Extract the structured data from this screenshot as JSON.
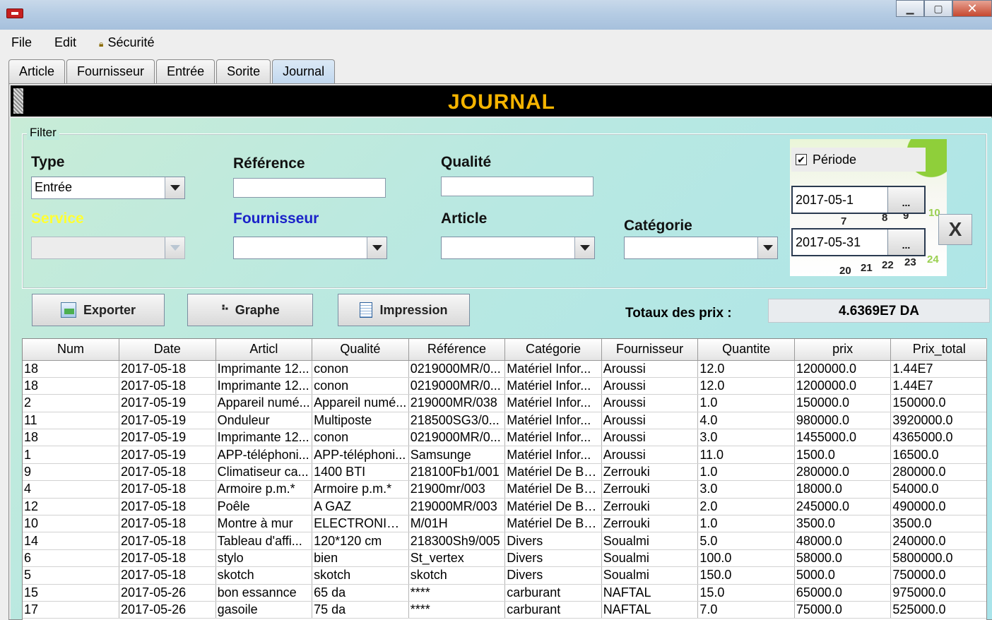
{
  "window": {
    "title": "",
    "minimize_glyph": "▁",
    "maximize_glyph": "▢",
    "close_glyph": "✕"
  },
  "menu": {
    "items": [
      "File",
      "Edit",
      "Sécurité"
    ]
  },
  "tabs": [
    {
      "label": "Article",
      "active": false
    },
    {
      "label": "Fournisseur",
      "active": false
    },
    {
      "label": "Entrée",
      "active": false
    },
    {
      "label": "Sorite",
      "active": false
    },
    {
      "label": "Journal",
      "active": true
    }
  ],
  "header": {
    "title": "JOURNAL"
  },
  "filter": {
    "legend": "Filter",
    "type_label": "Type",
    "type_value": "Entrée",
    "reference_label": "Référence",
    "reference_value": "",
    "qualite_label": "Qualité",
    "qualite_value": "",
    "service_label": "Service",
    "service_value": "",
    "fournisseur_label": "Fournisseur",
    "fournisseur_value": "",
    "article_label": "Article",
    "article_value": "",
    "categorie_label": "Catégorie",
    "categorie_value": "",
    "periode_label": "Période",
    "periode_checked": true,
    "date_from": "2017-05-1",
    "date_to": "2017-05-31",
    "date_button": "...",
    "clear_button": "X"
  },
  "actions": {
    "export_label": "Exporter",
    "graph_label": "Graphe",
    "print_label": "Impression",
    "total_label": "Totaux des prix :",
    "total_value": "4.6369E7 DA"
  },
  "table": {
    "columns": [
      "Num",
      "Date",
      "Articl",
      "Qualité",
      "Référence",
      "Catégorie",
      "Fournisseur",
      "Quantite",
      "prix",
      "Prix_total"
    ],
    "rows": [
      [
        "18",
        "2017-05-18",
        "Imprimante 12...",
        "conon",
        "0219000MR/0...",
        "Matériel Infor...",
        "Aroussi",
        "12.0",
        "1200000.0",
        "1.44E7"
      ],
      [
        "18",
        "2017-05-18",
        "Imprimante 12...",
        "conon",
        "0219000MR/0...",
        "Matériel Infor...",
        "Aroussi",
        "12.0",
        "1200000.0",
        "1.44E7"
      ],
      [
        "2",
        "2017-05-19",
        "Appareil numé...",
        "Appareil numé...",
        "219000MR/038",
        "Matériel Infor...",
        "Aroussi",
        "1.0",
        "150000.0",
        "150000.0"
      ],
      [
        "11",
        "2017-05-19",
        "Onduleur",
        "Multiposte",
        "218500SG3/0...",
        "Matériel Infor...",
        "Aroussi",
        "4.0",
        "980000.0",
        "3920000.0"
      ],
      [
        "18",
        "2017-05-19",
        "Imprimante 12...",
        "conon",
        "0219000MR/0...",
        "Matériel Infor...",
        "Aroussi",
        "3.0",
        "1455000.0",
        "4365000.0"
      ],
      [
        "1",
        "2017-05-19",
        "APP-téléphoni...",
        "APP-téléphoni...",
        "Samsunge",
        "Matériel Infor...",
        "Aroussi",
        "11.0",
        "1500.0",
        "16500.0"
      ],
      [
        "9",
        "2017-05-18",
        "Climatiseur ca...",
        "1400 BTI",
        "218100Fb1/001",
        "Matériel De Bu...",
        "Zerrouki",
        "1.0",
        "280000.0",
        "280000.0"
      ],
      [
        "4",
        "2017-05-18",
        "Armoire p.m.*",
        "Armoire p.m.*",
        "21900mr/003",
        "Matériel De Bu...",
        "Zerrouki",
        "3.0",
        "18000.0",
        "54000.0"
      ],
      [
        "12",
        "2017-05-18",
        "Poêle",
        "A  GAZ",
        "219000MR/003",
        "Matériel De Bu...",
        "Zerrouki",
        "2.0",
        "245000.0",
        "490000.0"
      ],
      [
        "10",
        "2017-05-18",
        "Montre à mur",
        "ELECTRONIQ...",
        "M/01H",
        "Matériel De Bu...",
        "Zerrouki",
        "1.0",
        "3500.0",
        "3500.0"
      ],
      [
        "14",
        "2017-05-18",
        "Tableau d'affi...",
        "120*120 cm",
        "218300Sh9/005",
        "Divers",
        "Soualmi",
        "5.0",
        "48000.0",
        "240000.0"
      ],
      [
        "6",
        "2017-05-18",
        "stylo",
        "bien",
        "St_vertex",
        "Divers",
        "Soualmi",
        "100.0",
        "58000.0",
        "5800000.0"
      ],
      [
        "5",
        "2017-05-18",
        "skotch",
        "skotch",
        "skotch",
        "Divers",
        "Soualmi",
        "150.0",
        "5000.0",
        "750000.0"
      ],
      [
        "15",
        "2017-05-26",
        "bon essannce",
        "65 da",
        "****",
        "carburant",
        "NAFTAL",
        "15.0",
        "65000.0",
        "975000.0"
      ],
      [
        "17",
        "2017-05-26",
        "gasoile",
        "75 da",
        "****",
        "carburant",
        "NAFTAL",
        "7.0",
        "75000.0",
        "525000.0"
      ]
    ]
  },
  "calendar_deco": [
    "7",
    "8",
    "9",
    "10",
    "20",
    "21",
    "22",
    "23",
    "24"
  ]
}
